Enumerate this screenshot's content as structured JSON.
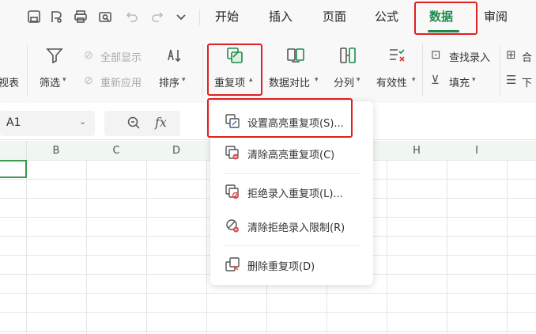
{
  "tabs": [
    {
      "label": "开始"
    },
    {
      "label": "插入"
    },
    {
      "label": "页面"
    },
    {
      "label": "公式"
    },
    {
      "label": "数据",
      "active": true
    },
    {
      "label": "审阅"
    }
  ],
  "ribbon": {
    "left_partial": "视表",
    "filter": "筛选",
    "show_all": "全部显示",
    "reapply": "重新应用",
    "sort": "排序",
    "duplicates": "重复项",
    "data_compare": "数据对比",
    "split": "分列",
    "validity": "有效性",
    "find_entry": "查找录入",
    "fill": "填充",
    "merge_partial": "合",
    "down_partial": "下"
  },
  "formula_bar": {
    "cell_ref": "A1",
    "fx": "fx"
  },
  "columns": [
    "B",
    "C",
    "D",
    "H",
    "I"
  ],
  "menu": {
    "items": [
      {
        "label": "设置高亮重复项(S)...",
        "icon": "highlight-duplicates-icon"
      },
      {
        "label": "清除高亮重复项(C)",
        "icon": "clear-highlight-icon"
      },
      {
        "label": "拒绝录入重复项(L)...",
        "icon": "reject-duplicates-icon"
      },
      {
        "label": "清除拒绝录入限制(R)",
        "icon": "clear-restriction-icon"
      },
      {
        "label": "删除重复项(D)",
        "icon": "delete-duplicates-icon"
      }
    ]
  },
  "colors": {
    "accent": "#1f8a4c",
    "highlight_box": "#e02020",
    "selection": "#3a9a4a"
  }
}
